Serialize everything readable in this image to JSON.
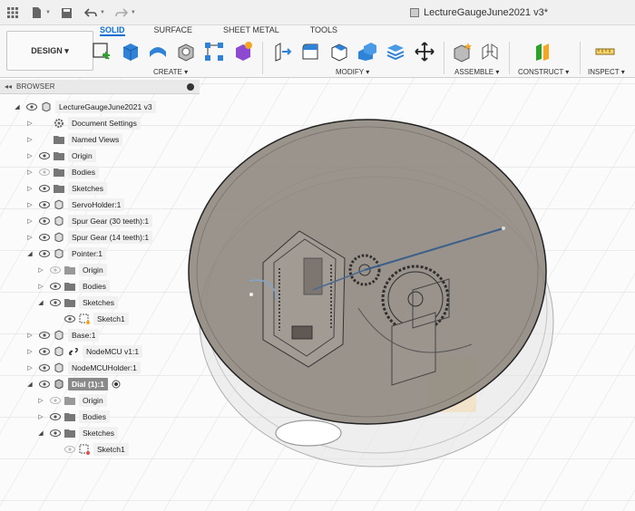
{
  "app": {
    "document_title": "LectureGaugeJune2021 v3*"
  },
  "ribbon": {
    "workspace_button": "DESIGN ▾",
    "tabs": [
      "SOLID",
      "SURFACE",
      "SHEET METAL",
      "TOOLS"
    ],
    "active_tab": "SOLID",
    "groups": {
      "create": "CREATE ▾",
      "modify": "MODIFY ▾",
      "assemble": "ASSEMBLE ▾",
      "construct": "CONSTRUCT ▾",
      "inspect": "INSPECT ▾"
    }
  },
  "browser": {
    "header": "BROWSER",
    "items": [
      {
        "label": "LectureGaugeJune2021 v3"
      },
      {
        "label": "Document Settings"
      },
      {
        "label": "Named Views"
      },
      {
        "label": "Origin"
      },
      {
        "label": "Bodies"
      },
      {
        "label": "Sketches"
      },
      {
        "label": "ServoHolder:1"
      },
      {
        "label": "Spur Gear (30 teeth):1"
      },
      {
        "label": "Spur Gear (14 teeth):1"
      },
      {
        "label": "Pointer:1"
      },
      {
        "label": "Origin"
      },
      {
        "label": "Bodies"
      },
      {
        "label": "Sketches"
      },
      {
        "label": "Sketch1"
      },
      {
        "label": "Base:1"
      },
      {
        "label": "NodeMCU v1:1"
      },
      {
        "label": "NodeMCUHolder:1"
      },
      {
        "label": "Dial (1):1"
      },
      {
        "label": "Origin"
      },
      {
        "label": "Bodies"
      },
      {
        "label": "Sketches"
      },
      {
        "label": "Sketch1"
      }
    ]
  },
  "colors": {
    "accent": "#0a6fd1",
    "dial_face": "#8f8880",
    "base_outline": "#b8b8b8"
  }
}
